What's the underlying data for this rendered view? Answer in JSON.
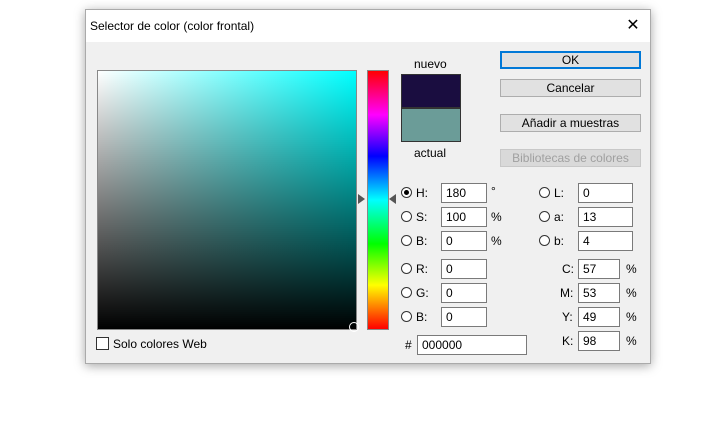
{
  "window": {
    "title": "Selector de color (color frontal)",
    "close": "✕"
  },
  "preview": {
    "new_label": "nuevo",
    "current_label": "actual",
    "new_color": "#1a0d40",
    "current_color": "#6b9c98"
  },
  "buttons": {
    "ok": "OK",
    "cancel": "Cancelar",
    "add_to_swatches": "Añadir a muestras",
    "color_libraries": "Bibliotecas de colores"
  },
  "hsb": {
    "h": {
      "label": "H:",
      "value": "180",
      "unit": "°"
    },
    "s": {
      "label": "S:",
      "value": "100",
      "unit": "%"
    },
    "b": {
      "label": "B:",
      "value": "0",
      "unit": "%"
    }
  },
  "rgb": {
    "r": {
      "label": "R:",
      "value": "0"
    },
    "g": {
      "label": "G:",
      "value": "0"
    },
    "b": {
      "label": "B:",
      "value": "0"
    }
  },
  "lab": {
    "l": {
      "label": "L:",
      "value": "0"
    },
    "a": {
      "label": "a:",
      "value": "13"
    },
    "b": {
      "label": "b:",
      "value": "4"
    }
  },
  "cmyk": {
    "c": {
      "label": "C:",
      "value": "57",
      "unit": "%"
    },
    "m": {
      "label": "M:",
      "value": "53",
      "unit": "%"
    },
    "y": {
      "label": "Y:",
      "value": "49",
      "unit": "%"
    },
    "k": {
      "label": "K:",
      "value": "98",
      "unit": "%"
    }
  },
  "hex": {
    "label": "#",
    "value": "000000"
  },
  "web_only": {
    "label": "Solo colores Web",
    "checked": false
  }
}
